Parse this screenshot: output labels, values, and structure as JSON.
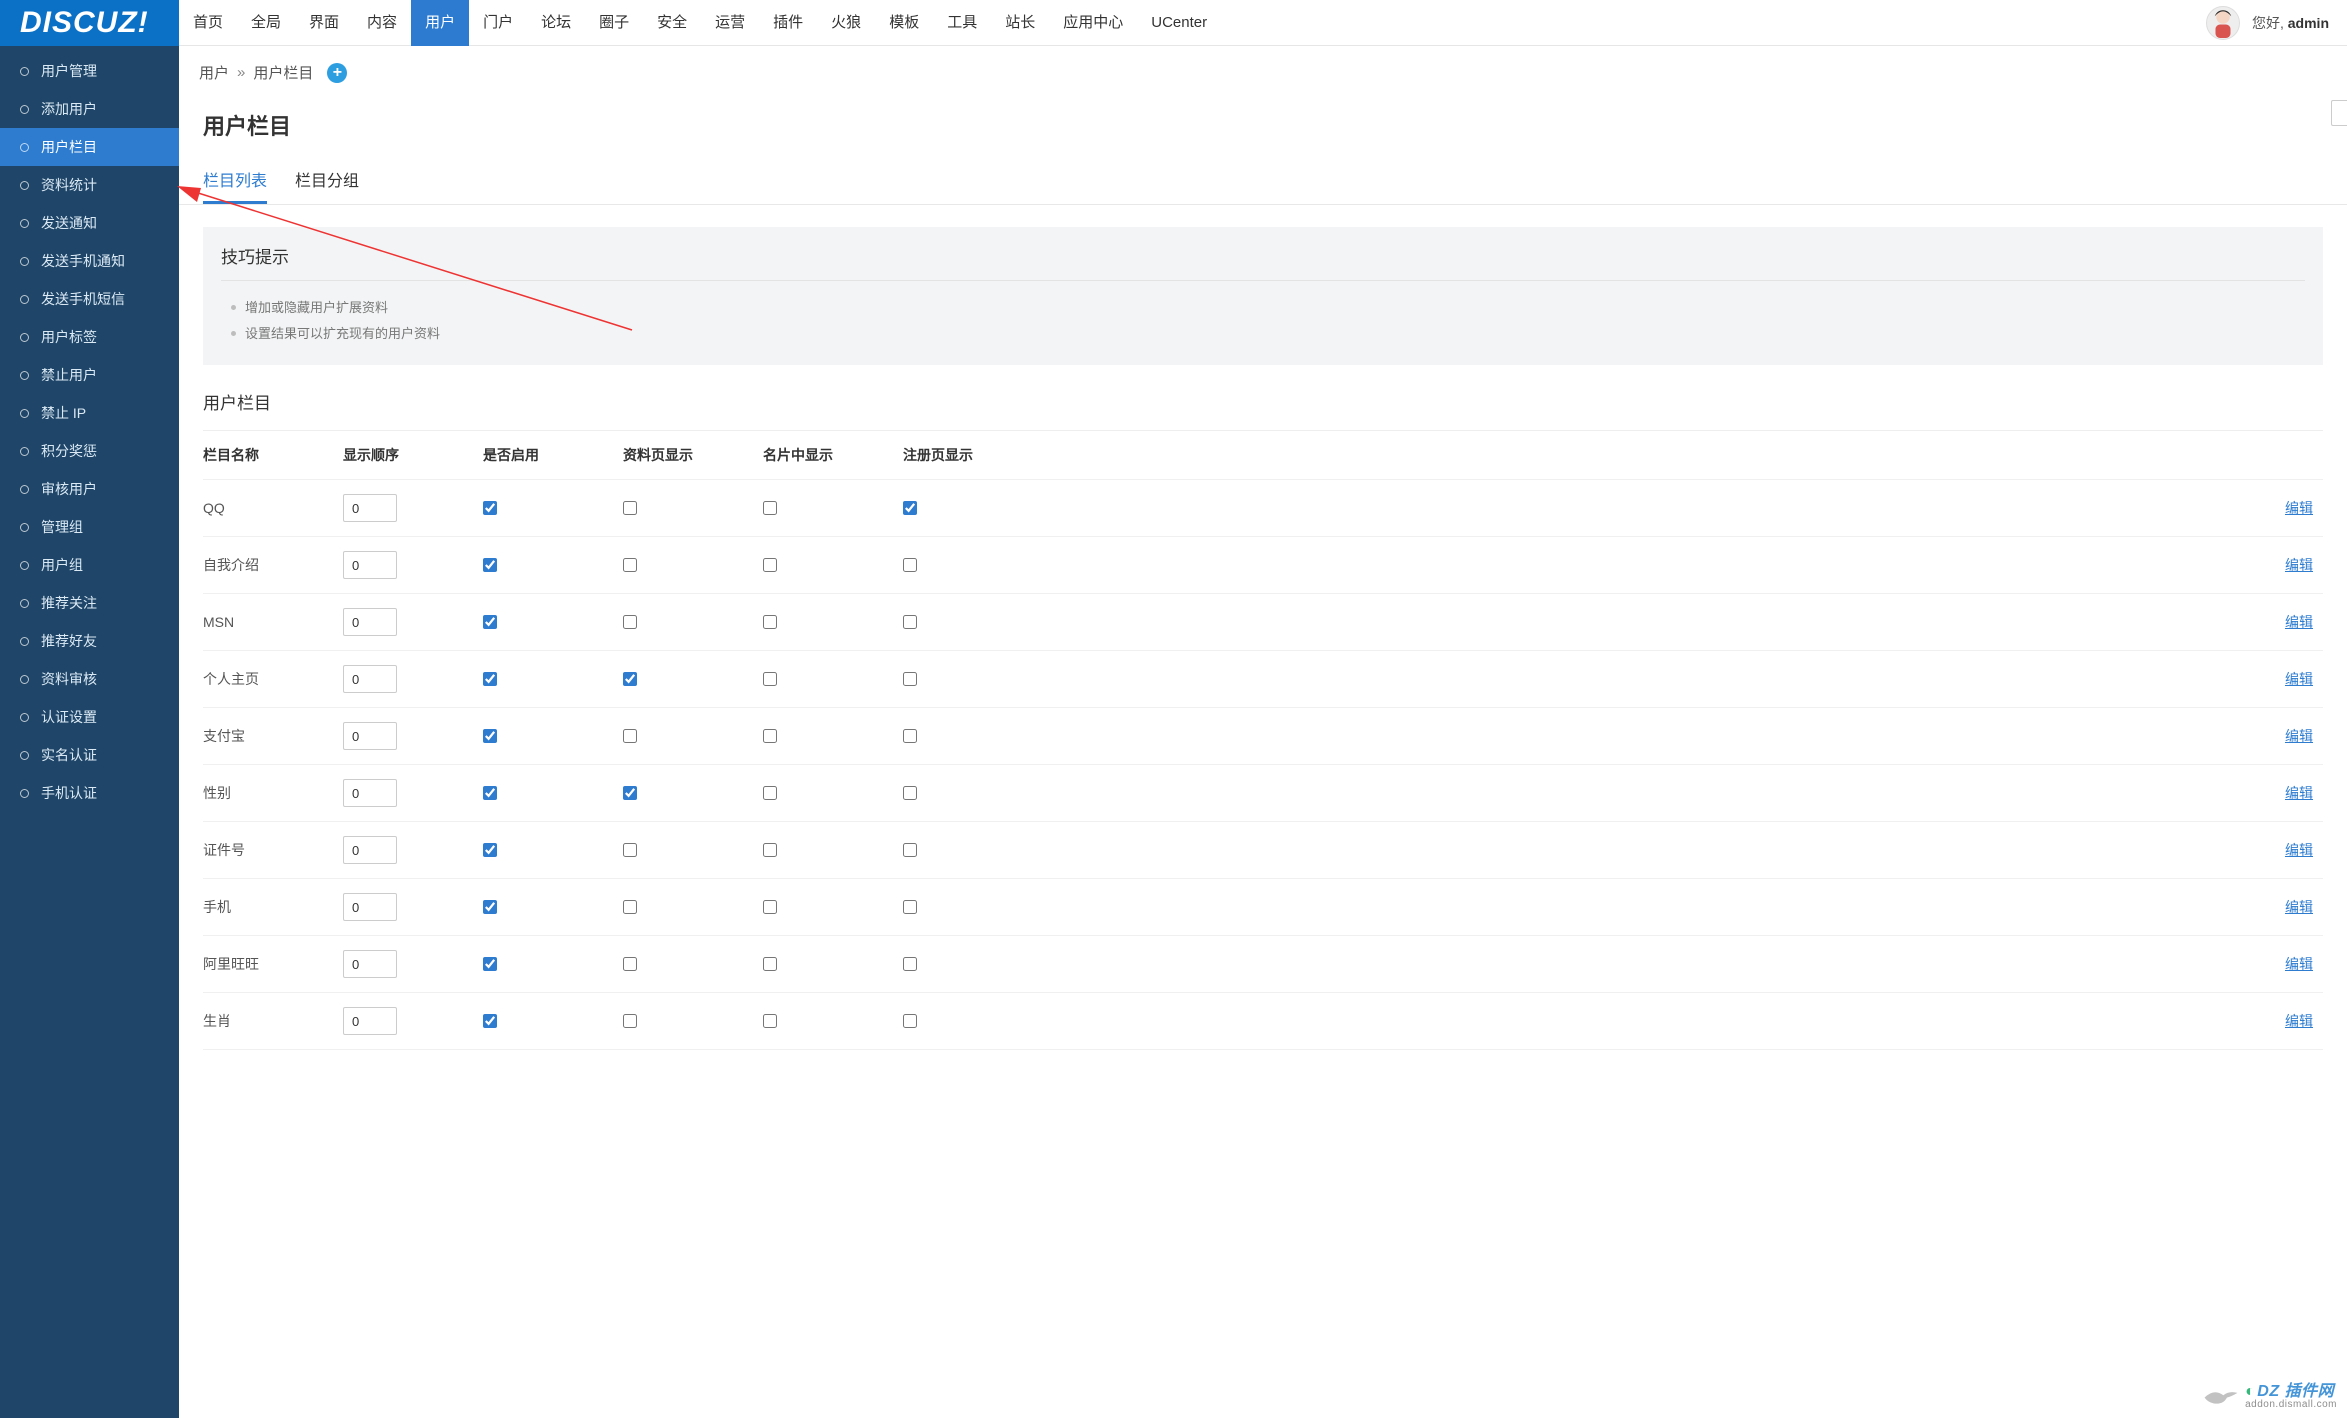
{
  "brand": "DISCUZ!",
  "topnav": [
    {
      "label": "首页"
    },
    {
      "label": "全局"
    },
    {
      "label": "界面"
    },
    {
      "label": "内容"
    },
    {
      "label": "用户",
      "active": true
    },
    {
      "label": "门户"
    },
    {
      "label": "论坛"
    },
    {
      "label": "圈子"
    },
    {
      "label": "安全"
    },
    {
      "label": "运营"
    },
    {
      "label": "插件"
    },
    {
      "label": "火狼"
    },
    {
      "label": "模板"
    },
    {
      "label": "工具"
    },
    {
      "label": "站长"
    },
    {
      "label": "应用中心"
    },
    {
      "label": "UCenter"
    }
  ],
  "greeting": {
    "prefix": "您好, ",
    "user": "admin"
  },
  "sidebar": [
    {
      "label": "用户管理"
    },
    {
      "label": "添加用户"
    },
    {
      "label": "用户栏目",
      "active": true
    },
    {
      "label": "资料统计"
    },
    {
      "label": "发送通知"
    },
    {
      "label": "发送手机通知"
    },
    {
      "label": "发送手机短信"
    },
    {
      "label": "用户标签"
    },
    {
      "label": "禁止用户"
    },
    {
      "label": "禁止 IP"
    },
    {
      "label": "积分奖惩"
    },
    {
      "label": "审核用户"
    },
    {
      "label": "管理组"
    },
    {
      "label": "用户组"
    },
    {
      "label": "推荐关注"
    },
    {
      "label": "推荐好友"
    },
    {
      "label": "资料审核"
    },
    {
      "label": "认证设置"
    },
    {
      "label": "实名认证"
    },
    {
      "label": "手机认证"
    }
  ],
  "breadcrumb": {
    "root": "用户",
    "sep": "»",
    "current": "用户栏目",
    "plus": "+"
  },
  "page_title": "用户栏目",
  "tabs": [
    {
      "label": "栏目列表",
      "active": true
    },
    {
      "label": "栏目分组"
    }
  ],
  "tips": {
    "title": "技巧提示",
    "items": [
      "增加或隐藏用户扩展资料",
      "设置结果可以扩充现有的用户资料"
    ]
  },
  "section_title": "用户栏目",
  "table": {
    "headers": [
      "栏目名称",
      "显示顺序",
      "是否启用",
      "资料页显示",
      "名片中显示",
      "注册页显示"
    ],
    "edit_label": "编辑",
    "rows": [
      {
        "name": "QQ",
        "order": "0",
        "enabled": true,
        "profile": false,
        "card": false,
        "register": true
      },
      {
        "name": "自我介绍",
        "order": "0",
        "enabled": true,
        "profile": false,
        "card": false,
        "register": false
      },
      {
        "name": "MSN",
        "order": "0",
        "enabled": true,
        "profile": false,
        "card": false,
        "register": false
      },
      {
        "name": "个人主页",
        "order": "0",
        "enabled": true,
        "profile": true,
        "card": false,
        "register": false
      },
      {
        "name": "支付宝",
        "order": "0",
        "enabled": true,
        "profile": false,
        "card": false,
        "register": false
      },
      {
        "name": "性别",
        "order": "0",
        "enabled": true,
        "profile": true,
        "card": false,
        "register": false
      },
      {
        "name": "证件号",
        "order": "0",
        "enabled": true,
        "profile": false,
        "card": false,
        "register": false
      },
      {
        "name": "手机",
        "order": "0",
        "enabled": true,
        "profile": false,
        "card": false,
        "register": false
      },
      {
        "name": "阿里旺旺",
        "order": "0",
        "enabled": true,
        "profile": false,
        "card": false,
        "register": false
      },
      {
        "name": "生肖",
        "order": "0",
        "enabled": true,
        "profile": false,
        "card": false,
        "register": false
      }
    ]
  },
  "watermark": {
    "brand": "DZ 插件网",
    "sub": "addon.dismall.com"
  }
}
